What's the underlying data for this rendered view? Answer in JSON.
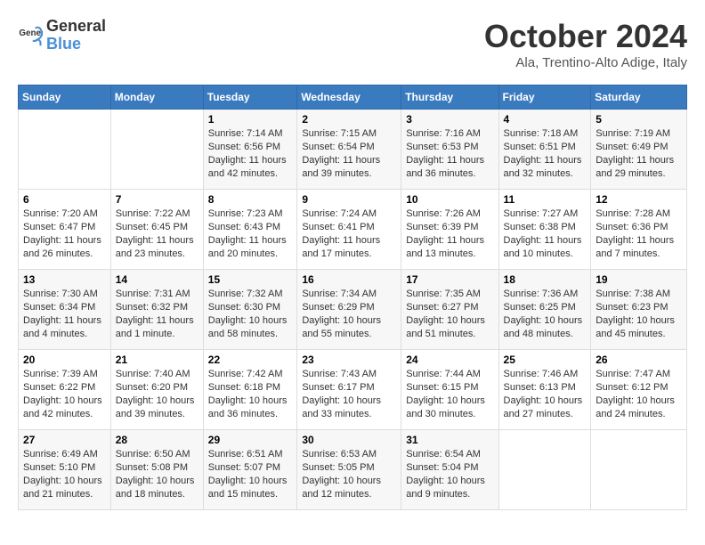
{
  "header": {
    "logo_line1": "General",
    "logo_line2": "Blue",
    "month": "October 2024",
    "location": "Ala, Trentino-Alto Adige, Italy"
  },
  "weekdays": [
    "Sunday",
    "Monday",
    "Tuesday",
    "Wednesday",
    "Thursday",
    "Friday",
    "Saturday"
  ],
  "weeks": [
    [
      {
        "day": "",
        "sunrise": "",
        "sunset": "",
        "daylight": ""
      },
      {
        "day": "",
        "sunrise": "",
        "sunset": "",
        "daylight": ""
      },
      {
        "day": "1",
        "sunrise": "Sunrise: 7:14 AM",
        "sunset": "Sunset: 6:56 PM",
        "daylight": "Daylight: 11 hours and 42 minutes."
      },
      {
        "day": "2",
        "sunrise": "Sunrise: 7:15 AM",
        "sunset": "Sunset: 6:54 PM",
        "daylight": "Daylight: 11 hours and 39 minutes."
      },
      {
        "day": "3",
        "sunrise": "Sunrise: 7:16 AM",
        "sunset": "Sunset: 6:53 PM",
        "daylight": "Daylight: 11 hours and 36 minutes."
      },
      {
        "day": "4",
        "sunrise": "Sunrise: 7:18 AM",
        "sunset": "Sunset: 6:51 PM",
        "daylight": "Daylight: 11 hours and 32 minutes."
      },
      {
        "day": "5",
        "sunrise": "Sunrise: 7:19 AM",
        "sunset": "Sunset: 6:49 PM",
        "daylight": "Daylight: 11 hours and 29 minutes."
      }
    ],
    [
      {
        "day": "6",
        "sunrise": "Sunrise: 7:20 AM",
        "sunset": "Sunset: 6:47 PM",
        "daylight": "Daylight: 11 hours and 26 minutes."
      },
      {
        "day": "7",
        "sunrise": "Sunrise: 7:22 AM",
        "sunset": "Sunset: 6:45 PM",
        "daylight": "Daylight: 11 hours and 23 minutes."
      },
      {
        "day": "8",
        "sunrise": "Sunrise: 7:23 AM",
        "sunset": "Sunset: 6:43 PM",
        "daylight": "Daylight: 11 hours and 20 minutes."
      },
      {
        "day": "9",
        "sunrise": "Sunrise: 7:24 AM",
        "sunset": "Sunset: 6:41 PM",
        "daylight": "Daylight: 11 hours and 17 minutes."
      },
      {
        "day": "10",
        "sunrise": "Sunrise: 7:26 AM",
        "sunset": "Sunset: 6:39 PM",
        "daylight": "Daylight: 11 hours and 13 minutes."
      },
      {
        "day": "11",
        "sunrise": "Sunrise: 7:27 AM",
        "sunset": "Sunset: 6:38 PM",
        "daylight": "Daylight: 11 hours and 10 minutes."
      },
      {
        "day": "12",
        "sunrise": "Sunrise: 7:28 AM",
        "sunset": "Sunset: 6:36 PM",
        "daylight": "Daylight: 11 hours and 7 minutes."
      }
    ],
    [
      {
        "day": "13",
        "sunrise": "Sunrise: 7:30 AM",
        "sunset": "Sunset: 6:34 PM",
        "daylight": "Daylight: 11 hours and 4 minutes."
      },
      {
        "day": "14",
        "sunrise": "Sunrise: 7:31 AM",
        "sunset": "Sunset: 6:32 PM",
        "daylight": "Daylight: 11 hours and 1 minute."
      },
      {
        "day": "15",
        "sunrise": "Sunrise: 7:32 AM",
        "sunset": "Sunset: 6:30 PM",
        "daylight": "Daylight: 10 hours and 58 minutes."
      },
      {
        "day": "16",
        "sunrise": "Sunrise: 7:34 AM",
        "sunset": "Sunset: 6:29 PM",
        "daylight": "Daylight: 10 hours and 55 minutes."
      },
      {
        "day": "17",
        "sunrise": "Sunrise: 7:35 AM",
        "sunset": "Sunset: 6:27 PM",
        "daylight": "Daylight: 10 hours and 51 minutes."
      },
      {
        "day": "18",
        "sunrise": "Sunrise: 7:36 AM",
        "sunset": "Sunset: 6:25 PM",
        "daylight": "Daylight: 10 hours and 48 minutes."
      },
      {
        "day": "19",
        "sunrise": "Sunrise: 7:38 AM",
        "sunset": "Sunset: 6:23 PM",
        "daylight": "Daylight: 10 hours and 45 minutes."
      }
    ],
    [
      {
        "day": "20",
        "sunrise": "Sunrise: 7:39 AM",
        "sunset": "Sunset: 6:22 PM",
        "daylight": "Daylight: 10 hours and 42 minutes."
      },
      {
        "day": "21",
        "sunrise": "Sunrise: 7:40 AM",
        "sunset": "Sunset: 6:20 PM",
        "daylight": "Daylight: 10 hours and 39 minutes."
      },
      {
        "day": "22",
        "sunrise": "Sunrise: 7:42 AM",
        "sunset": "Sunset: 6:18 PM",
        "daylight": "Daylight: 10 hours and 36 minutes."
      },
      {
        "day": "23",
        "sunrise": "Sunrise: 7:43 AM",
        "sunset": "Sunset: 6:17 PM",
        "daylight": "Daylight: 10 hours and 33 minutes."
      },
      {
        "day": "24",
        "sunrise": "Sunrise: 7:44 AM",
        "sunset": "Sunset: 6:15 PM",
        "daylight": "Daylight: 10 hours and 30 minutes."
      },
      {
        "day": "25",
        "sunrise": "Sunrise: 7:46 AM",
        "sunset": "Sunset: 6:13 PM",
        "daylight": "Daylight: 10 hours and 27 minutes."
      },
      {
        "day": "26",
        "sunrise": "Sunrise: 7:47 AM",
        "sunset": "Sunset: 6:12 PM",
        "daylight": "Daylight: 10 hours and 24 minutes."
      }
    ],
    [
      {
        "day": "27",
        "sunrise": "Sunrise: 6:49 AM",
        "sunset": "Sunset: 5:10 PM",
        "daylight": "Daylight: 10 hours and 21 minutes."
      },
      {
        "day": "28",
        "sunrise": "Sunrise: 6:50 AM",
        "sunset": "Sunset: 5:08 PM",
        "daylight": "Daylight: 10 hours and 18 minutes."
      },
      {
        "day": "29",
        "sunrise": "Sunrise: 6:51 AM",
        "sunset": "Sunset: 5:07 PM",
        "daylight": "Daylight: 10 hours and 15 minutes."
      },
      {
        "day": "30",
        "sunrise": "Sunrise: 6:53 AM",
        "sunset": "Sunset: 5:05 PM",
        "daylight": "Daylight: 10 hours and 12 minutes."
      },
      {
        "day": "31",
        "sunrise": "Sunrise: 6:54 AM",
        "sunset": "Sunset: 5:04 PM",
        "daylight": "Daylight: 10 hours and 9 minutes."
      },
      {
        "day": "",
        "sunrise": "",
        "sunset": "",
        "daylight": ""
      },
      {
        "day": "",
        "sunrise": "",
        "sunset": "",
        "daylight": ""
      }
    ]
  ]
}
